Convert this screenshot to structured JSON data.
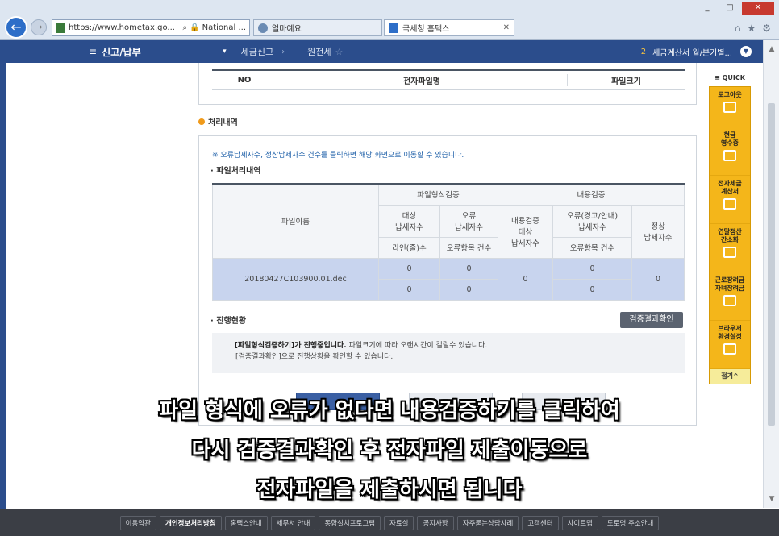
{
  "browser": {
    "address": "https://www.hometax.go...",
    "cert": "National ...",
    "tabs": [
      {
        "label": "얼마예요"
      },
      {
        "label": "국세청 홈택스"
      }
    ],
    "window_controls": [
      "_",
      "□",
      "✕"
    ]
  },
  "nav": {
    "title": "신고/납부",
    "crumbs": [
      "세금신고",
      "원천세"
    ],
    "notice_num": "2",
    "notice_text": "세금계산서 월/분기별..."
  },
  "top_table": {
    "headers": [
      "NO",
      "전자파일명",
      "파일크기"
    ]
  },
  "section_title": "처리내역",
  "note": "※ 오류납세자수, 정상납세자수 건수를 클릭하면 해당 화면으로 이동할 수 있습니다.",
  "subhead": "· 파일처리내역",
  "result_table": {
    "file_name_header": "파일이름",
    "format_check_header": "파일형식검증",
    "content_check_header": "내용검증",
    "target_taxpayers": "대상\n납세자수",
    "error_taxpayers": "오류\n납세자수",
    "content_target": "내용검증\n대상\n납세자수",
    "error_warn": "오류(경고/안내)\n납세자수",
    "normal_taxpayers": "정상\n납세자수",
    "line_count": "라인(줄)수",
    "error_item_count": "오류항목 건수",
    "error_item_count2": "오류항목 건수",
    "row": {
      "file": "20180427C103900.01.dec",
      "target": "0",
      "error": "0",
      "line": "0",
      "error_items": "0",
      "content_target": "0",
      "warn": "0",
      "warn_items": "0",
      "normal": "0"
    }
  },
  "progress": {
    "title": "· 진행현황",
    "verify_button": "검증결과확인",
    "msg_line1_bold": "[파일형식검증하기]가 진행중입니다.",
    "msg_line1_rest": " 파일크기에 따라 오랜시간이 걸릴수 있습니다.",
    "msg_line2": "[검증결과확인]으로 진행상황을 확인할 수 있습니다."
  },
  "quick": {
    "header": "≡ QUICK",
    "items": [
      {
        "label": "로그아웃"
      },
      {
        "label": "현금\n영수증"
      },
      {
        "label": "전자세금\n계산서"
      },
      {
        "label": "연말정산\n간소화"
      },
      {
        "label": "근로장려금\n자녀장려금"
      },
      {
        "label": "브라우저\n환경설정"
      }
    ],
    "footer": "접기^"
  },
  "subtitles": [
    "파일 형식에 오류가 없다면 내용검증하기를 클릭하여",
    "다시 검증결과확인 후 전자파일 제출이동으로",
    "전자파일을 제출하시면 됩니다"
  ],
  "footer_links": [
    "이용약관",
    "개인정보처리방침",
    "홈택스안내",
    "세무서 안내",
    "통합설치프로그램",
    "자료실",
    "공지사항",
    "자주묻는상담사례",
    "고객센터",
    "사이트맵",
    "도로명 주소안내"
  ]
}
